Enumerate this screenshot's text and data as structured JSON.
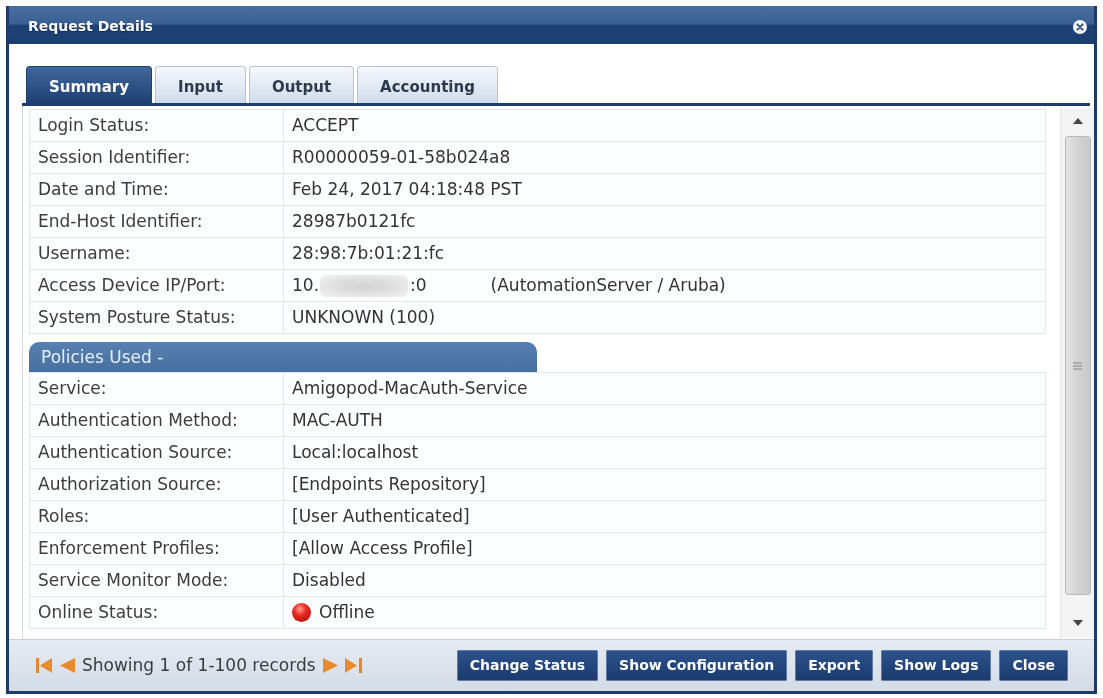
{
  "window": {
    "title": "Request Details"
  },
  "tabs": [
    {
      "label": "Summary",
      "selected": true
    },
    {
      "label": "Input",
      "selected": false
    },
    {
      "label": "Output",
      "selected": false
    },
    {
      "label": "Accounting",
      "selected": false
    }
  ],
  "summary": {
    "rows": [
      {
        "kind": "text",
        "label": "Login Status:",
        "value": "ACCEPT"
      },
      {
        "kind": "text",
        "label": "Session Identifier:",
        "value": "R00000059-01-58b024a8"
      },
      {
        "kind": "text",
        "label": "Date and Time:",
        "value": "Feb 24, 2017 04:18:48 PST"
      },
      {
        "kind": "text",
        "label": "End-Host Identifier:",
        "value": "28987b0121fc"
      },
      {
        "kind": "text",
        "label": "Username:",
        "value": "28:98:7b:01:21:fc"
      },
      {
        "kind": "address",
        "label": "Access Device IP/Port:",
        "ip_start": "10.",
        "redacted": true,
        "port": ":0",
        "device": "(AutomationServer / Aruba)"
      },
      {
        "kind": "text",
        "label": "System Posture Status:",
        "value": "UNKNOWN (100)"
      }
    ]
  },
  "policies": {
    "title": "Policies Used -",
    "rows": [
      {
        "kind": "text",
        "label": "Service:",
        "value": "Amigopod-MacAuth-Service"
      },
      {
        "kind": "text",
        "label": "Authentication Method:",
        "value": "MAC-AUTH"
      },
      {
        "kind": "text",
        "label": "Authentication Source:",
        "value": "Local:localhost"
      },
      {
        "kind": "text",
        "label": "Authorization Source:",
        "value": "[Endpoints Repository]"
      },
      {
        "kind": "text",
        "label": "Roles:",
        "value": "[User Authenticated]"
      },
      {
        "kind": "text",
        "label": "Enforcement Profiles:",
        "value": "[Allow Access Profile]"
      },
      {
        "kind": "text",
        "label": "Service Monitor Mode:",
        "value": "Disabled"
      },
      {
        "kind": "status",
        "label": "Online Status:",
        "value": "Offline",
        "online": false
      }
    ]
  },
  "pager": {
    "text": "Showing 1 of 1-100 records"
  },
  "buttons": [
    {
      "label": "Change Status"
    },
    {
      "label": "Show Configuration"
    },
    {
      "label": "Export"
    },
    {
      "label": "Show Logs"
    },
    {
      "label": "Close"
    }
  ]
}
